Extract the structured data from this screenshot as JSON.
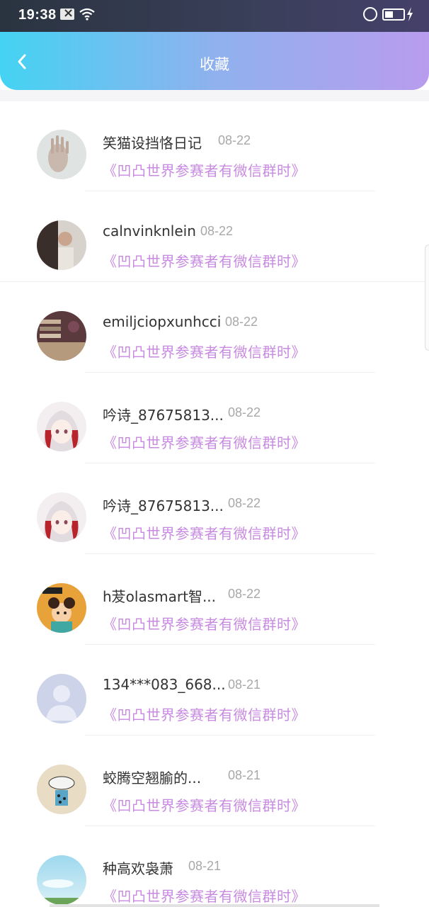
{
  "status_bar": {
    "time": "19:38",
    "icons": [
      "mail-x-icon",
      "wifi-icon",
      "rotation-lock-icon",
      "battery-icon",
      "charging-bolt-icon"
    ]
  },
  "header": {
    "title": "收藏",
    "back_icon": "chevron-left-icon",
    "gradient_start": "#44d3f3",
    "gradient_end": "#b89cee"
  },
  "colors": {
    "title_accent": "#c88ae0",
    "date_gray": "#a8a8a8",
    "name_text": "#333333"
  },
  "items": [
    {
      "name": "笑猫设挡恪日记",
      "date": "08-22",
      "title": "《凹凸世界参赛者有微信群时》",
      "avatar": "hand-photo"
    },
    {
      "name": "calnvinknlein",
      "date": "08-22",
      "title": "《凹凸世界参赛者有微信群时》",
      "avatar": "person-photo"
    },
    {
      "name": "emiljciopxunhcci",
      "date": "08-22",
      "title": "《凹凸世界参赛者有微信群时》",
      "avatar": "bookshelf-photo"
    },
    {
      "name": "吟诗_87675813...",
      "date": "08-22",
      "title": "《凹凸世界参赛者有微信群时》",
      "avatar": "anime-girl"
    },
    {
      "name": "吟诗_87675813...",
      "date": "08-22",
      "title": "《凹凸世界参赛者有微信群时》",
      "avatar": "anime-girl"
    },
    {
      "name": "h茇olasmart智...",
      "date": "08-22",
      "title": "《凹凸世界参赛者有微信群时》",
      "avatar": "cartoon-girl"
    },
    {
      "name": "134***083_668...",
      "date": "08-21",
      "title": "《凹凸世界参赛者有微信群时》",
      "avatar": "default-user"
    },
    {
      "name": "蛟腾空翘腧的...",
      "date": "08-21",
      "title": "《凹凸世界参赛者有微信群时》",
      "avatar": "cartoon-cat"
    },
    {
      "name": "种高欢袅萧",
      "date": "08-21",
      "title": "《凹凸世界参赛者有微信群时》",
      "avatar": "sky-photo"
    }
  ]
}
